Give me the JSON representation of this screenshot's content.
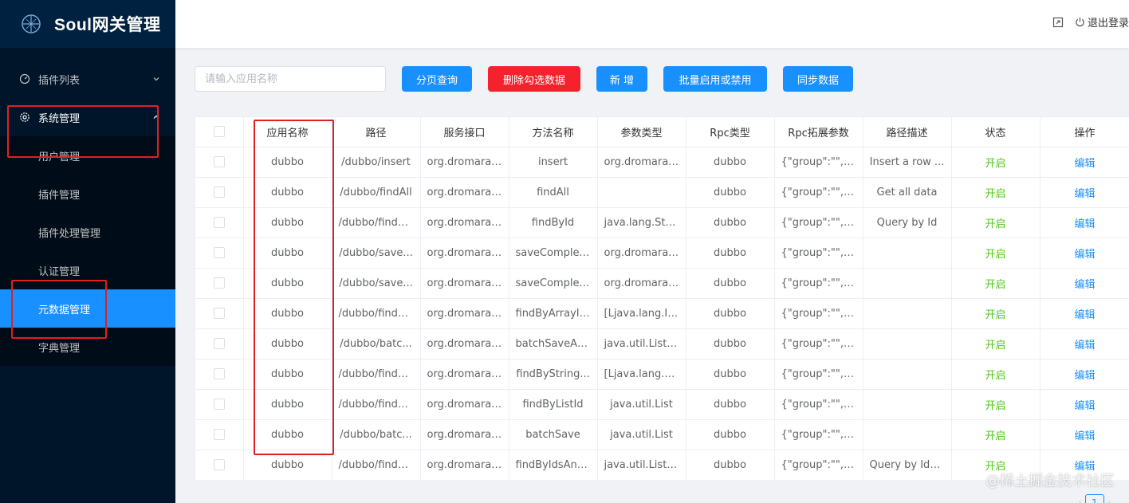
{
  "app": {
    "title": "Soul网关管理"
  },
  "header": {
    "logout_label": "退出登录"
  },
  "sidebar": {
    "items": [
      {
        "label": "插件列表",
        "icon": "dashboard-icon",
        "expanded": false
      },
      {
        "label": "系统管理",
        "icon": "gear-icon",
        "expanded": true,
        "children": [
          {
            "label": "用户管理"
          },
          {
            "label": "插件管理"
          },
          {
            "label": "插件处理管理"
          },
          {
            "label": "认证管理"
          },
          {
            "label": "元数据管理",
            "active": true
          },
          {
            "label": "字典管理"
          }
        ]
      }
    ]
  },
  "toolbar": {
    "search_placeholder": "请输入应用名称",
    "buttons": {
      "query": "分页查询",
      "delete_selected": "删除勾选数据",
      "add": "新 增",
      "batch_toggle": "批量启用或禁用",
      "sync": "同步数据"
    }
  },
  "table": {
    "columns": [
      "应用名称",
      "路径",
      "服务接口",
      "方法名称",
      "参数类型",
      "Rpc类型",
      "Rpc拓展参数",
      "路径描述",
      "状态",
      "操作"
    ],
    "rows": [
      {
        "app": "dubbo",
        "path": "/dubbo/insert",
        "service": "org.dromara....",
        "method": "insert",
        "params": "org.dromara....",
        "rpc": "dubbo",
        "ext": "{\"group\":\"\",\"v...",
        "desc": "Insert a row ...",
        "status": "开启",
        "op": "编辑"
      },
      {
        "app": "dubbo",
        "path": "/dubbo/findAll",
        "service": "org.dromara....",
        "method": "findAll",
        "params": "",
        "rpc": "dubbo",
        "ext": "{\"group\":\"\",\"v...",
        "desc": "Get all data",
        "status": "开启",
        "op": "编辑"
      },
      {
        "app": "dubbo",
        "path": "/dubbo/findB...",
        "service": "org.dromara....",
        "method": "findById",
        "params": "java.lang.String",
        "rpc": "dubbo",
        "ext": "{\"group\":\"\",\"v...",
        "desc": "Query by Id",
        "status": "开启",
        "op": "编辑"
      },
      {
        "app": "dubbo",
        "path": "/dubbo/save...",
        "service": "org.dromara....",
        "method": "saveComplex...",
        "params": "org.dromara....",
        "rpc": "dubbo",
        "ext": "{\"group\":\"\",\"v...",
        "desc": "",
        "status": "开启",
        "op": "编辑"
      },
      {
        "app": "dubbo",
        "path": "/dubbo/save...",
        "service": "org.dromara....",
        "method": "saveComplex...",
        "params": "org.dromara....",
        "rpc": "dubbo",
        "ext": "{\"group\":\"\",\"v...",
        "desc": "",
        "status": "开启",
        "op": "编辑"
      },
      {
        "app": "dubbo",
        "path": "/dubbo/findB...",
        "service": "org.dromara....",
        "method": "findByArrayId...",
        "params": "[Ljava.lang.In...",
        "rpc": "dubbo",
        "ext": "{\"group\":\"\",\"v...",
        "desc": "",
        "status": "开启",
        "op": "编辑"
      },
      {
        "app": "dubbo",
        "path": "/dubbo/batc...",
        "service": "org.dromara....",
        "method": "batchSaveAn...",
        "params": "java.util.List,j...",
        "rpc": "dubbo",
        "ext": "{\"group\":\"\",\"v...",
        "desc": "",
        "status": "开启",
        "op": "编辑"
      },
      {
        "app": "dubbo",
        "path": "/dubbo/findB...",
        "service": "org.dromara....",
        "method": "findByString...",
        "params": "[Ljava.lang.St...",
        "rpc": "dubbo",
        "ext": "{\"group\":\"\",\"v...",
        "desc": "",
        "status": "开启",
        "op": "编辑"
      },
      {
        "app": "dubbo",
        "path": "/dubbo/findB...",
        "service": "org.dromara....",
        "method": "findByListId",
        "params": "java.util.List",
        "rpc": "dubbo",
        "ext": "{\"group\":\"\",\"v...",
        "desc": "",
        "status": "开启",
        "op": "编辑"
      },
      {
        "app": "dubbo",
        "path": "/dubbo/batc...",
        "service": "org.dromara....",
        "method": "batchSave",
        "params": "java.util.List",
        "rpc": "dubbo",
        "ext": "{\"group\":\"\",\"v...",
        "desc": "",
        "status": "开启",
        "op": "编辑"
      },
      {
        "app": "dubbo",
        "path": "/dubbo/findB...",
        "service": "org.dromara....",
        "method": "findByIdsAnd...",
        "params": "java.util.List,j...",
        "rpc": "dubbo",
        "ext": "{\"group\":\"\",\"v...",
        "desc": "Query by Ids ...",
        "status": "开启",
        "op": "编辑"
      }
    ]
  },
  "pagination": {
    "current_page": "1"
  },
  "watermark": "@稀土掘金技术社区",
  "colors": {
    "primary": "#1890ff",
    "danger": "#f5222d",
    "sidebar": "#001529",
    "status_on": "#52c41a",
    "highlight": "#e02020"
  }
}
